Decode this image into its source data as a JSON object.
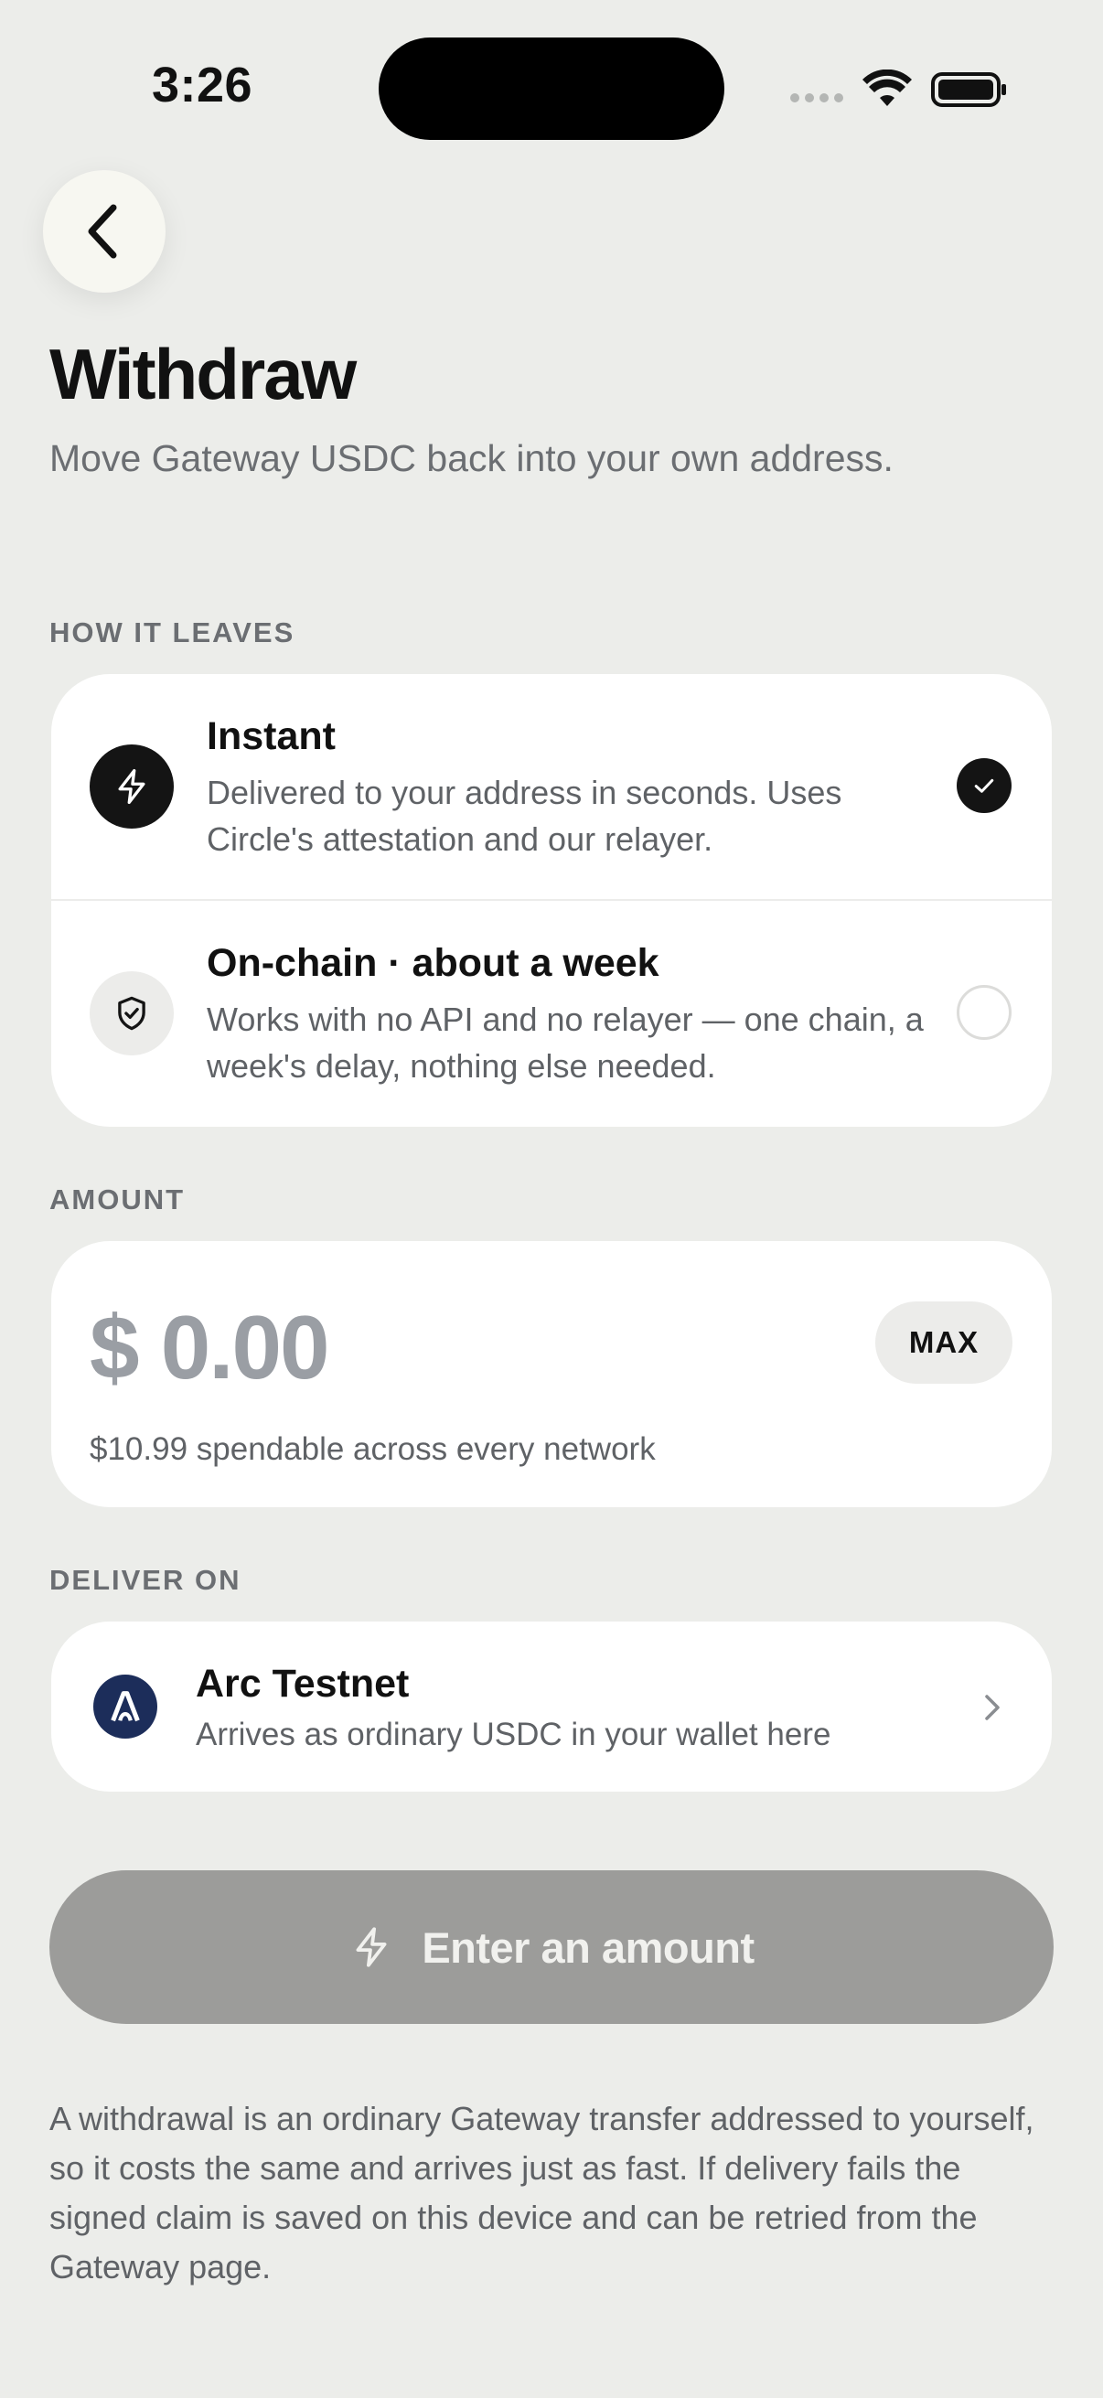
{
  "status_bar": {
    "time": "3:26"
  },
  "header": {
    "title": "Withdraw",
    "subtitle": "Move Gateway USDC back into your own address."
  },
  "method_section": {
    "label": "HOW IT LEAVES",
    "options": [
      {
        "title": "Instant",
        "description": "Delivered to your address in seconds. Uses Circle's attestation and our relayer.",
        "icon": "lightning-icon",
        "selected": true
      },
      {
        "title": "On-chain · about a week",
        "description": "Works with no API and no relayer — one chain, a week's delay, nothing else needed.",
        "icon": "shield-check-icon",
        "selected": false
      }
    ]
  },
  "amount_section": {
    "label": "AMOUNT",
    "value": "$ 0.00",
    "max_label": "MAX",
    "hint": "$10.99 spendable across every network"
  },
  "deliver_section": {
    "label": "DELIVER ON",
    "network_name": "Arc Testnet",
    "network_desc": "Arrives as ordinary USDC in your wallet here"
  },
  "cta": {
    "label": "Enter an amount",
    "icon": "lightning-icon",
    "enabled": false
  },
  "footnote": "A withdrawal is an ordinary Gateway transfer addressed to yourself, so it costs the same and arrives just as fast. If delivery fails the signed claim is saved on this device and can be retried from the Gateway page.",
  "colors": {
    "background": "#ecedea",
    "card": "#ffffff",
    "accent": "#141414",
    "cta_disabled": "#9c9c9a",
    "network_logo": "#1c2d5a"
  }
}
